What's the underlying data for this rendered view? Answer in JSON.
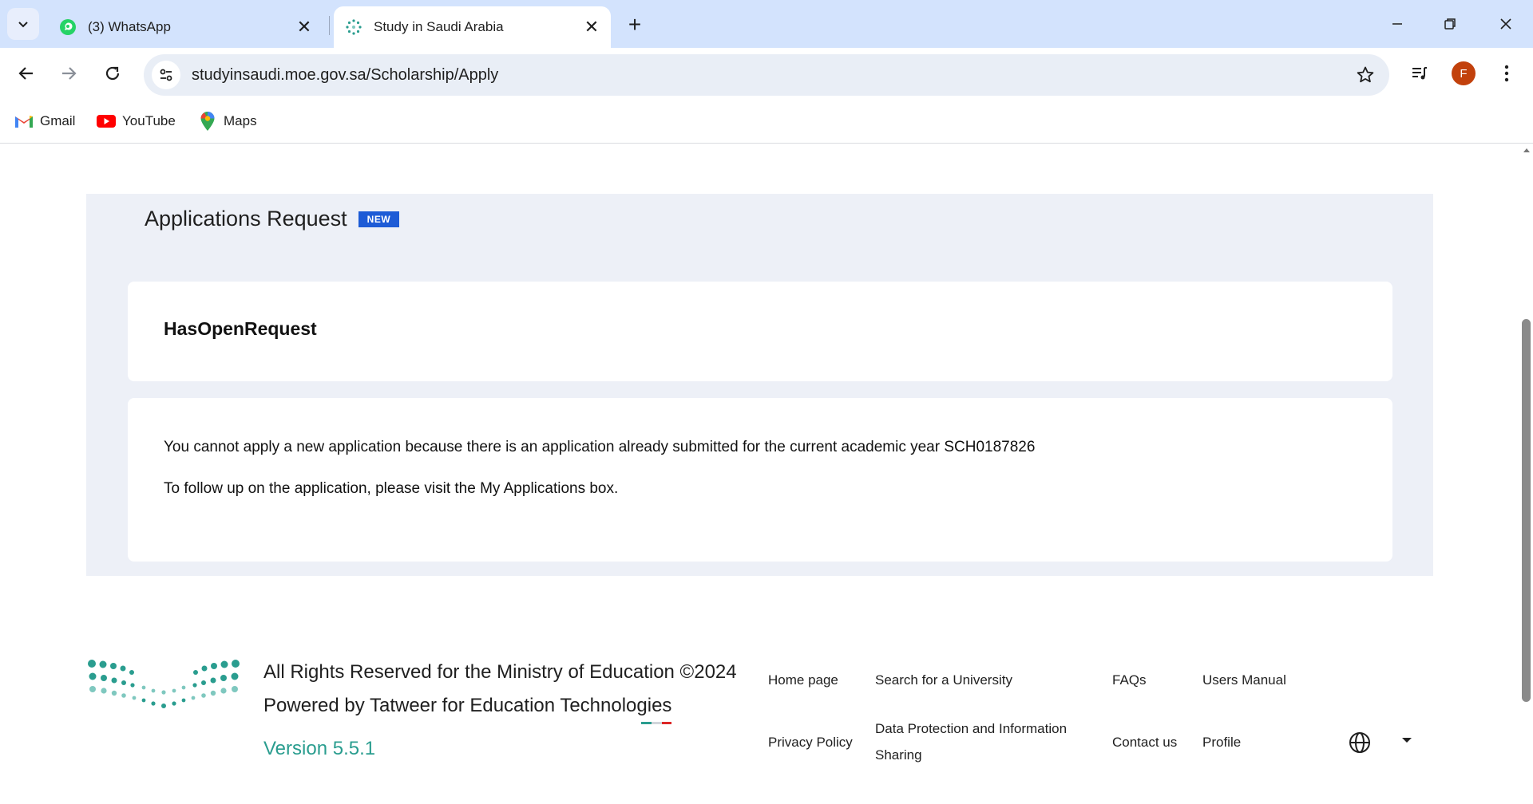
{
  "browser": {
    "tabs": [
      {
        "title": "(3) WhatsApp",
        "favicon": "whatsapp-icon",
        "active": false
      },
      {
        "title": "Study in Saudi Arabia",
        "favicon": "study-in-saudi-icon",
        "active": true
      }
    ],
    "url": "studyinsaudi.moe.gov.sa/Scholarship/Apply",
    "profile_initial": "F",
    "bookmarks": [
      {
        "label": "Gmail",
        "icon": "gmail-icon"
      },
      {
        "label": "YouTube",
        "icon": "youtube-icon"
      },
      {
        "label": "Maps",
        "icon": "maps-icon"
      }
    ]
  },
  "page": {
    "title": "Applications Request",
    "badge": "NEW",
    "status_heading": "HasOpenRequest",
    "message_line1": "You cannot apply a new application because there is an application already submitted for the current academic year  SCH0187826",
    "message_line2": "To follow up on the application, please visit the My Applications box."
  },
  "footer": {
    "copyright": "All Rights Reserved for the Ministry of Education ©2024",
    "powered_by": "Powered by Tatweer for Education Technologies",
    "version": "Version 5.5.1",
    "links": {
      "home": "Home page",
      "search_university": "Search for a University",
      "faqs": "FAQs",
      "users_manual": "Users Manual",
      "privacy": "Privacy Policy",
      "data_protection_1": "Data Protection and Information",
      "data_protection_2": "Sharing",
      "contact": "Contact us",
      "profile": "Profile"
    }
  },
  "colors": {
    "tabstrip": "#d3e3fd",
    "panel_bg": "#edf0f7",
    "badge": "#1d5bd6",
    "version_teal": "#2a9d8f",
    "avatar": "#c2410c"
  }
}
